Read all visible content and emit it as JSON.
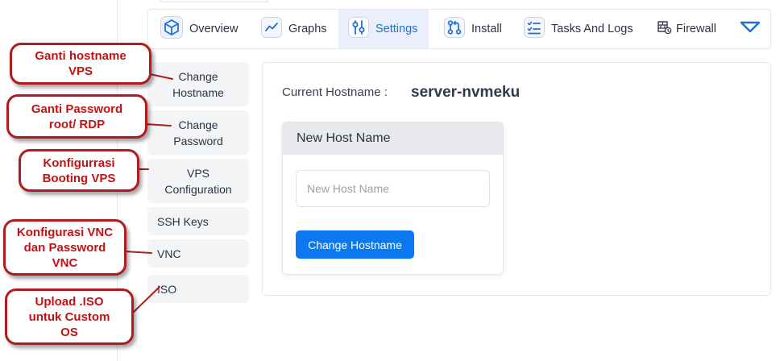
{
  "tabs": [
    {
      "label": "Overview",
      "icon": "cube-icon"
    },
    {
      "label": "Graphs",
      "icon": "chart-line-icon"
    },
    {
      "label": "Settings",
      "icon": "sliders-icon",
      "active": true
    },
    {
      "label": "Install",
      "icon": "git-branch-icon"
    },
    {
      "label": "Tasks And Logs",
      "icon": "checklist-icon"
    },
    {
      "label": "Firewall",
      "icon": "firewall-icon"
    }
  ],
  "sidebar": {
    "items": [
      {
        "label": "Change Hostname"
      },
      {
        "label": "Change Password"
      },
      {
        "label": "VPS Configuration"
      },
      {
        "label": "SSH Keys"
      },
      {
        "label": "VNC"
      },
      {
        "label": "ISO"
      }
    ]
  },
  "main": {
    "current_hostname_label": "Current Hostname :",
    "current_hostname_value": "server-nvmeku",
    "card_title": "New Host Name",
    "input_placeholder": "New Host Name",
    "input_value": "",
    "button_label": "Change Hostname"
  },
  "callouts": [
    {
      "text": "Ganti hostname VPS"
    },
    {
      "text": "Ganti Password root/ RDP"
    },
    {
      "text": "Konfigurrasi Booting VPS"
    },
    {
      "text": "Konfigurasi VNC dan Password VNC"
    },
    {
      "text": "Upload .ISO untuk Custom OS"
    }
  ],
  "colors": {
    "accent": "#0b78f0",
    "active_tab_bg": "#e9f0fb",
    "callout_border": "#b01c1c",
    "callout_text": "#c41212"
  }
}
